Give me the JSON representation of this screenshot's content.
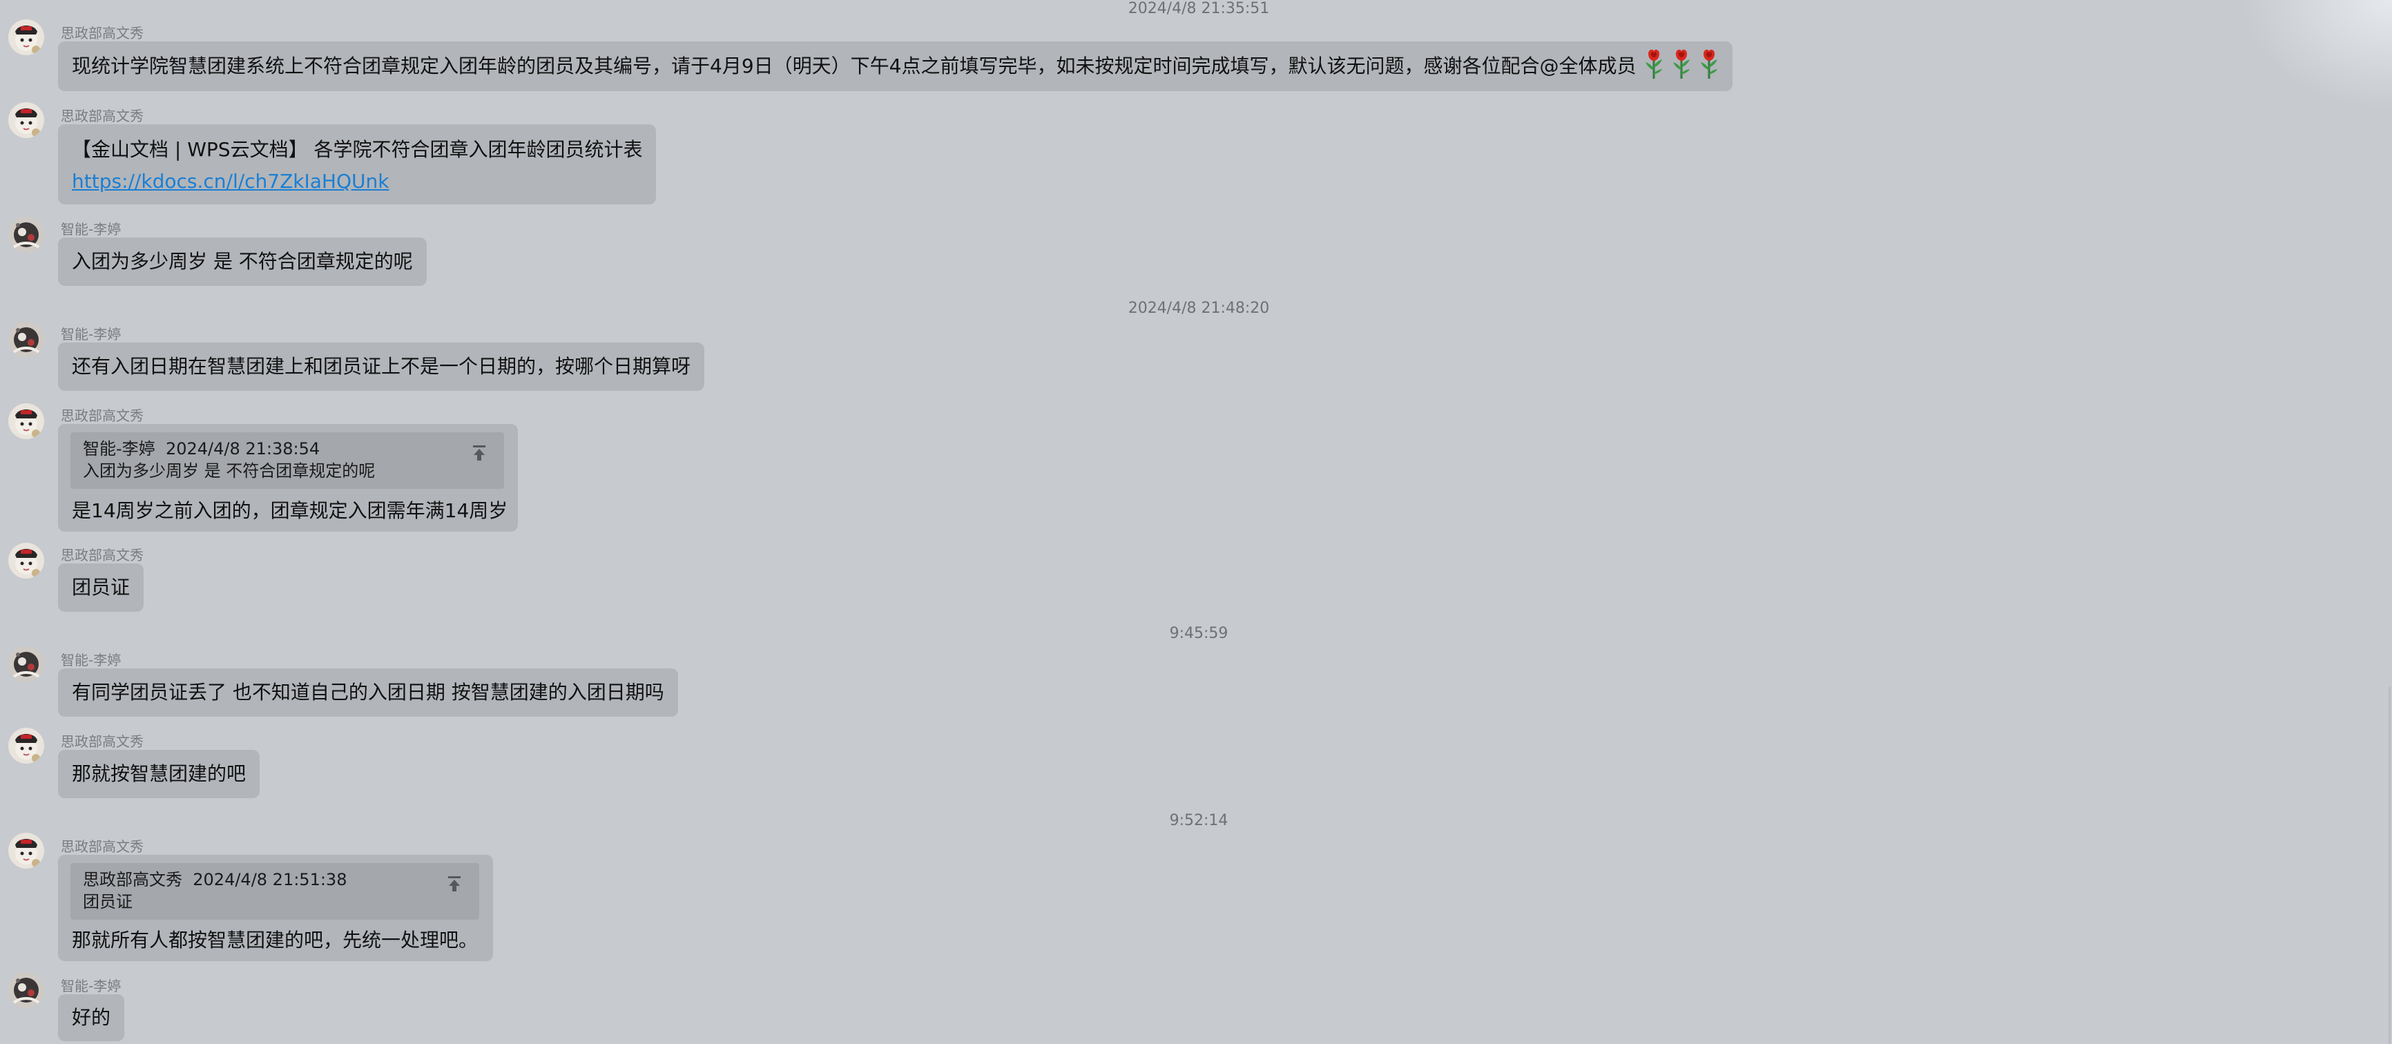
{
  "chat": {
    "timestamps": [
      "2024/4/8 21:35:51",
      "2024/4/8 21:48:20",
      "9:45:59",
      "9:52:14"
    ],
    "messages": [
      {
        "sender": "思政部高文秀",
        "avatar": "avatar-gao",
        "lines": [
          "现统计学院智慧团建系统上不符合团章规定入团年龄的团员及其编号，请于4月9日（明天）下午4点之前填写完毕，如未按规定时间完成填写，默认该无问题，感谢各位配合@全体成员"
        ],
        "emoji": [
          "rose-icon",
          "rose-icon",
          "rose-icon"
        ]
      },
      {
        "sender": "思政部高文秀",
        "avatar": "avatar-gao",
        "lines": [
          "【金山文档 | WPS云文档】 各学院不符合团章入团年龄团员统计表"
        ],
        "link": "https://kdocs.cn/l/ch7ZkIaHQUnk"
      },
      {
        "sender": "智能-李婷",
        "avatar": "avatar-li",
        "lines": [
          "入团为多少周岁 是 不符合团章规定的呢"
        ]
      },
      {
        "sender": "智能-李婷",
        "avatar": "avatar-li",
        "lines": [
          "还有入团日期在智慧团建上和团员证上不是一个日期的，按哪个日期算呀"
        ]
      },
      {
        "sender": "思政部高文秀",
        "avatar": "avatar-gao",
        "quote": {
          "author": "智能-李婷",
          "time": "2024/4/8 21:38:54",
          "text": "入团为多少周岁 是 不符合团章规定的呢"
        },
        "lines": [
          "是14周岁之前入团的，团章规定入团需年满14周岁"
        ]
      },
      {
        "sender": "思政部高文秀",
        "avatar": "avatar-gao",
        "lines": [
          "团员证"
        ]
      },
      {
        "sender": "智能-李婷",
        "avatar": "avatar-li",
        "lines": [
          "有同学团员证丢了 也不知道自己的入团日期 按智慧团建的入团日期吗"
        ]
      },
      {
        "sender": "思政部高文秀",
        "avatar": "avatar-gao",
        "lines": [
          "那就按智慧团建的吧"
        ]
      },
      {
        "sender": "思政部高文秀",
        "avatar": "avatar-gao",
        "quote": {
          "author": "思政部高文秀",
          "time": "2024/4/8 21:51:38",
          "text": "团员证"
        },
        "lines": [
          "那就所有人都按智慧团建的吧，先统一处理吧。"
        ]
      },
      {
        "sender": "智能-李婷",
        "avatar": "avatar-li",
        "lines": [
          "好的"
        ]
      }
    ]
  },
  "colors": {
    "background": "#c7cacf",
    "bubble": "#b2b5ba",
    "quote": "#a4a7ac",
    "link": "#1a7fd4",
    "timestamp": "#6e7074",
    "sender": "#7a7c80"
  }
}
